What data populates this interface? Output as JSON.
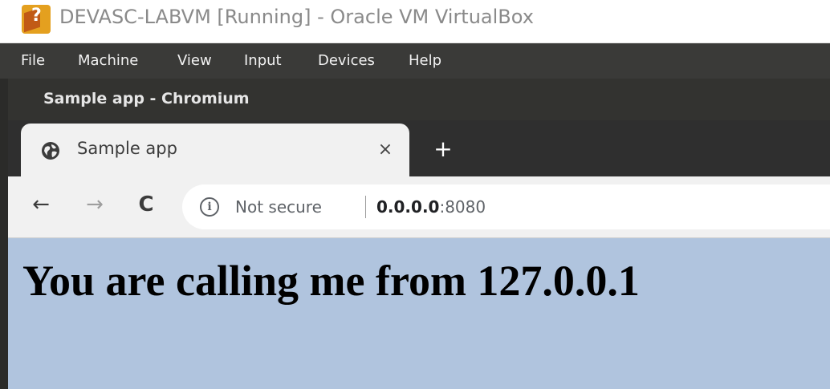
{
  "host_window": {
    "title": "DEVASC-LABVM [Running] - Oracle VM VirtualBox",
    "menu": [
      "File",
      "Machine",
      "View",
      "Input",
      "Devices",
      "Help"
    ]
  },
  "browser": {
    "window_title": "Sample app - Chromium",
    "tab": {
      "title": "Sample app",
      "icon": "globe-icon",
      "close_glyph": "×"
    },
    "new_tab_glyph": "+",
    "nav": {
      "back": "←",
      "forward": "→",
      "reload": "C"
    },
    "omnibox": {
      "info_glyph": "i",
      "security_text": "Not secure",
      "url_host": "0.0.0.0",
      "url_port": ":8080"
    }
  },
  "page": {
    "heading": "You are calling me from 127.0.0.1",
    "background_color": "#b0c4de"
  }
}
